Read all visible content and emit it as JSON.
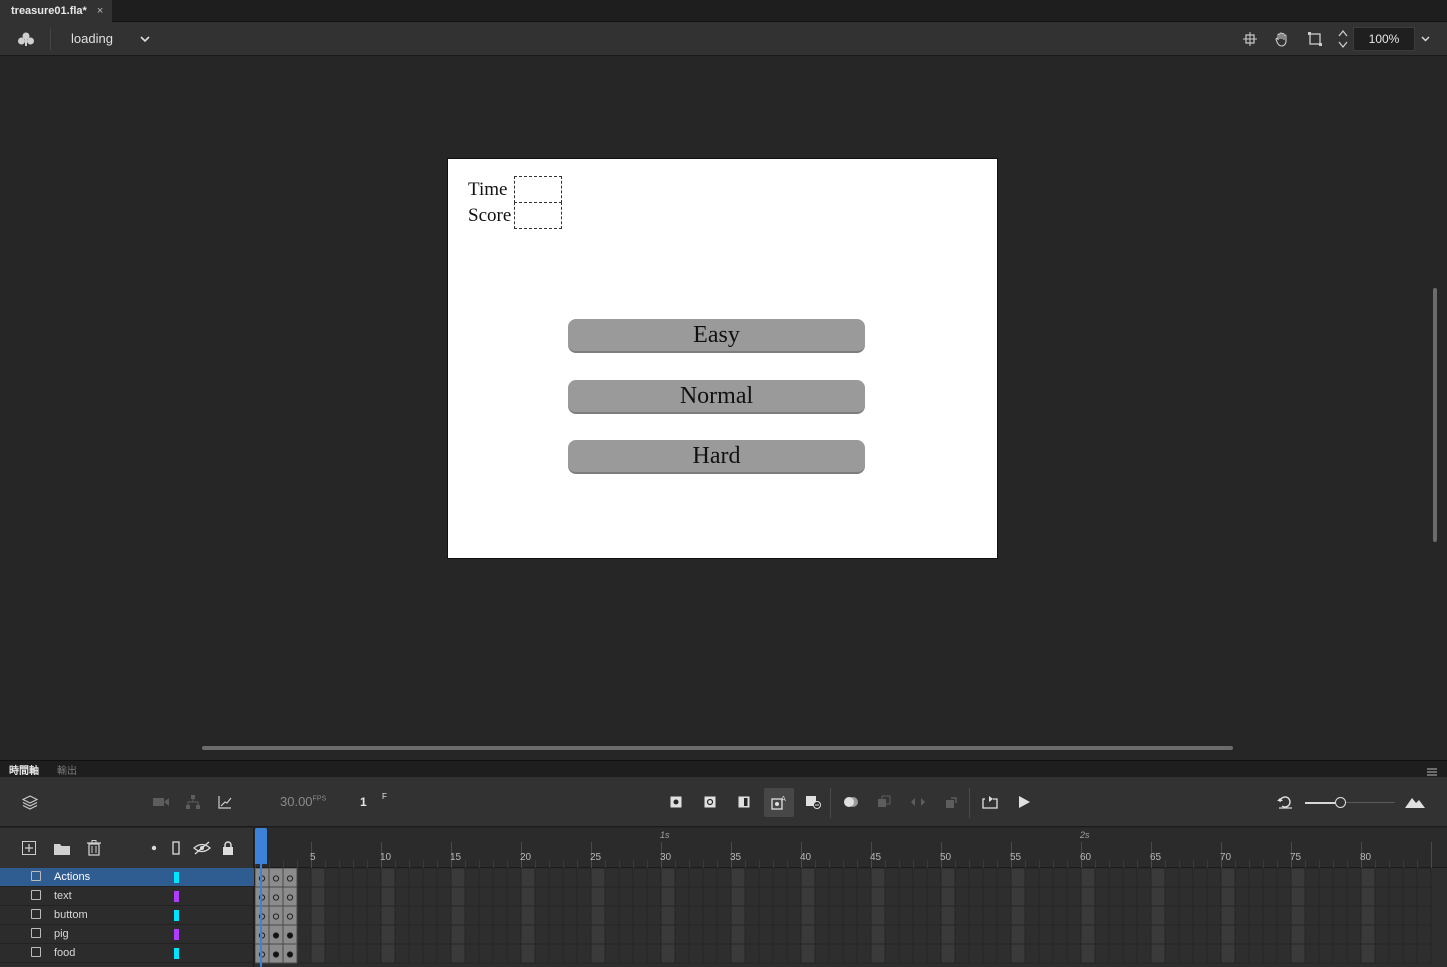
{
  "tab": {
    "title": "treasure01.fla*",
    "close": "×"
  },
  "editbar": {
    "scene": "loading",
    "zoom": "100%"
  },
  "stage": {
    "time_label": "Time",
    "score_label": "Score",
    "buttons": [
      "Easy",
      "Normal",
      "Hard"
    ]
  },
  "panels": {
    "timeline_tab": "時間軸",
    "output_tab": "輸出"
  },
  "timeline": {
    "fps": "30.00",
    "fps_unit": "FPS",
    "current_frame": "1",
    "frame_unit": "F",
    "ruler_numbers": [
      "5",
      "10",
      "15",
      "20",
      "25",
      "30",
      "35",
      "40",
      "45",
      "50",
      "55",
      "60",
      "65",
      "70",
      "75",
      "80"
    ],
    "ruler_seconds": [
      "1s",
      "2s"
    ],
    "layers": [
      {
        "name": "Actions",
        "color": "#00e5ff",
        "selected": true
      },
      {
        "name": "text",
        "color": "#b03cff",
        "selected": false
      },
      {
        "name": "buttom",
        "color": "#00e5ff",
        "selected": false
      },
      {
        "name": "pig",
        "color": "#b03cff",
        "selected": false
      },
      {
        "name": "food",
        "color": "#00e5ff",
        "selected": false
      }
    ]
  },
  "colors": {
    "accent": "#3d82d9",
    "selection": "#2f5c91",
    "stage": "#ffffff",
    "button": "#9a9a9a"
  }
}
